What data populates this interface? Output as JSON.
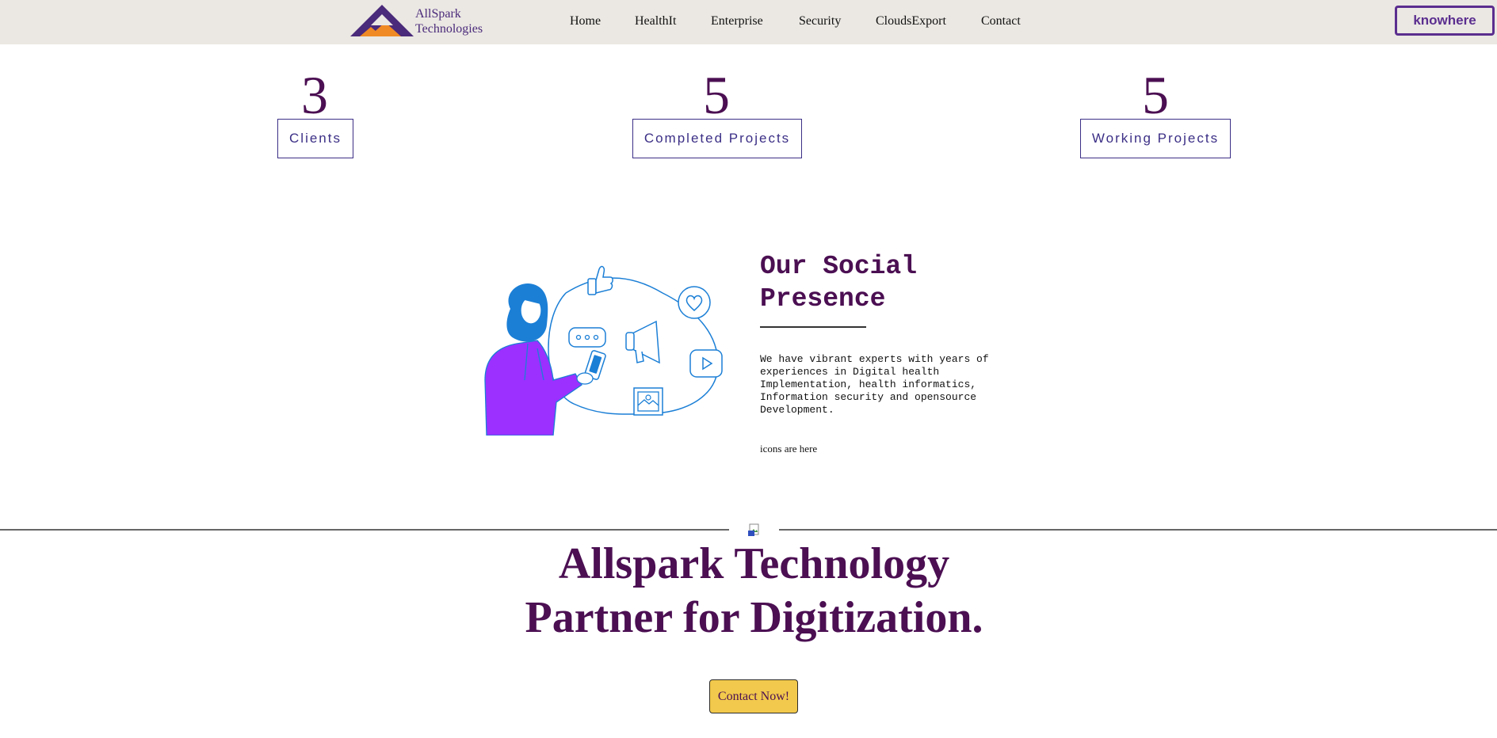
{
  "nav": {
    "brand_line1": "AllSpark",
    "brand_line2": "Technologies",
    "links": [
      "Home",
      "HealthIt",
      "Enterprise",
      "Security",
      "CloudsExport",
      "Contact"
    ],
    "cta": "knowhere"
  },
  "stats": [
    {
      "value": "3",
      "label": "Clients"
    },
    {
      "value": "5",
      "label": "Completed Projects"
    },
    {
      "value": "5",
      "label": "Working Projects"
    }
  ],
  "social": {
    "title_line1": "Our Social",
    "title_line2": "Presence",
    "text": "We have vibrant experts with years of experiences in Digital health Implementation, health informatics, Information security and opensource Development.",
    "icons_note": "icons are here"
  },
  "hero": {
    "line1": "Allspark Technology",
    "line2": "Partner for Digitization.",
    "button": "Contact Now!"
  },
  "colors": {
    "brand_purple": "#4b0f52",
    "nav_bg": "#ebe8e3",
    "cta_border": "#5b2e8f",
    "stat_border": "#3b2f86",
    "contact_bg": "#f2c94c",
    "logo_orange": "#f08a24"
  }
}
